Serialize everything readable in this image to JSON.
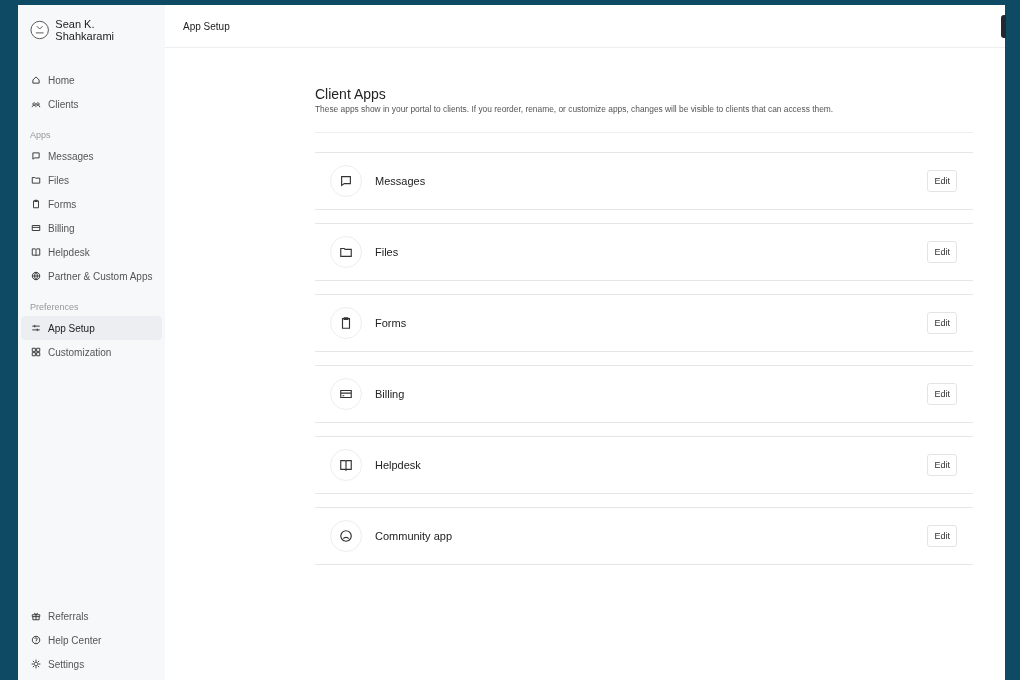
{
  "user": {
    "name": "Sean K. Shahkarami"
  },
  "nav_top": [
    {
      "label": "Home",
      "selected": false
    },
    {
      "label": "Clients",
      "selected": false
    }
  ],
  "sections": [
    {
      "title": "Apps",
      "items": [
        {
          "label": "Messages",
          "selected": false
        },
        {
          "label": "Files",
          "selected": false
        },
        {
          "label": "Forms",
          "selected": false
        },
        {
          "label": "Billing",
          "selected": false
        },
        {
          "label": "Helpdesk",
          "selected": false
        },
        {
          "label": "Partner & Custom Apps",
          "selected": false
        }
      ]
    },
    {
      "title": "Preferences",
      "items": [
        {
          "label": "App Setup",
          "selected": true
        },
        {
          "label": "Customization",
          "selected": false
        }
      ]
    }
  ],
  "nav_bottom": [
    {
      "label": "Referrals",
      "selected": false
    },
    {
      "label": "Help Center",
      "selected": false
    },
    {
      "label": "Settings",
      "selected": false
    }
  ],
  "header": {
    "title": "App Setup"
  },
  "content": {
    "title": "Client Apps",
    "description": "These apps show in your portal to clients. If you reorder, rename, or customize apps, changes will be visible to clients that can access them.",
    "apps": [
      {
        "name": "Messages",
        "button": "Edit"
      },
      {
        "name": "Files",
        "button": "Edit"
      },
      {
        "name": "Forms",
        "button": "Edit"
      },
      {
        "name": "Billing",
        "button": "Edit"
      },
      {
        "name": "Helpdesk",
        "button": "Edit"
      },
      {
        "name": "Community app",
        "button": "Edit"
      }
    ]
  }
}
